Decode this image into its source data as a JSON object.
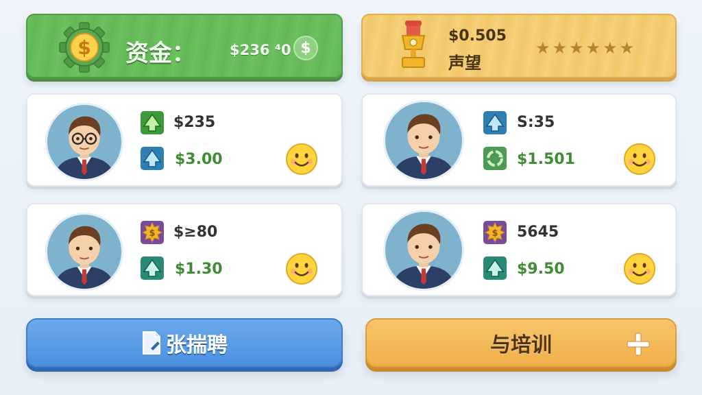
{
  "funds": {
    "label": "资金：",
    "value": "$236 ⁴0",
    "coin_symbol": "$"
  },
  "reputation": {
    "value": "$0.505",
    "label": "声望",
    "stars": 6
  },
  "employees": [
    {
      "stat1": "$235",
      "stat2": "$3.00",
      "glasses": true,
      "icon1": "green-arrow-icon",
      "icon2": "blue-arrow-icon"
    },
    {
      "stat1": "S:35",
      "stat2": "$1.501",
      "glasses": false,
      "icon1": "blue-arrow-icon",
      "icon2": "green-recycle-icon"
    },
    {
      "stat1": "$≥80",
      "stat2": "$1.30",
      "glasses": false,
      "icon1": "coin-burst-icon",
      "icon2": "teal-arrow-icon"
    },
    {
      "stat1": "5645",
      "stat2": "$9.50",
      "glasses": false,
      "icon1": "coin-burst-icon",
      "icon2": "teal-arrow-icon"
    }
  ],
  "buttons": {
    "hire": "张揣聘",
    "train": "与培训"
  },
  "colors": {
    "funds_bar": "#6cbf5e",
    "reputation_bar": "#f6cf76",
    "hire_button": "#5a9de5",
    "train_button": "#f3b957",
    "stat_green": "#3f8d33"
  }
}
